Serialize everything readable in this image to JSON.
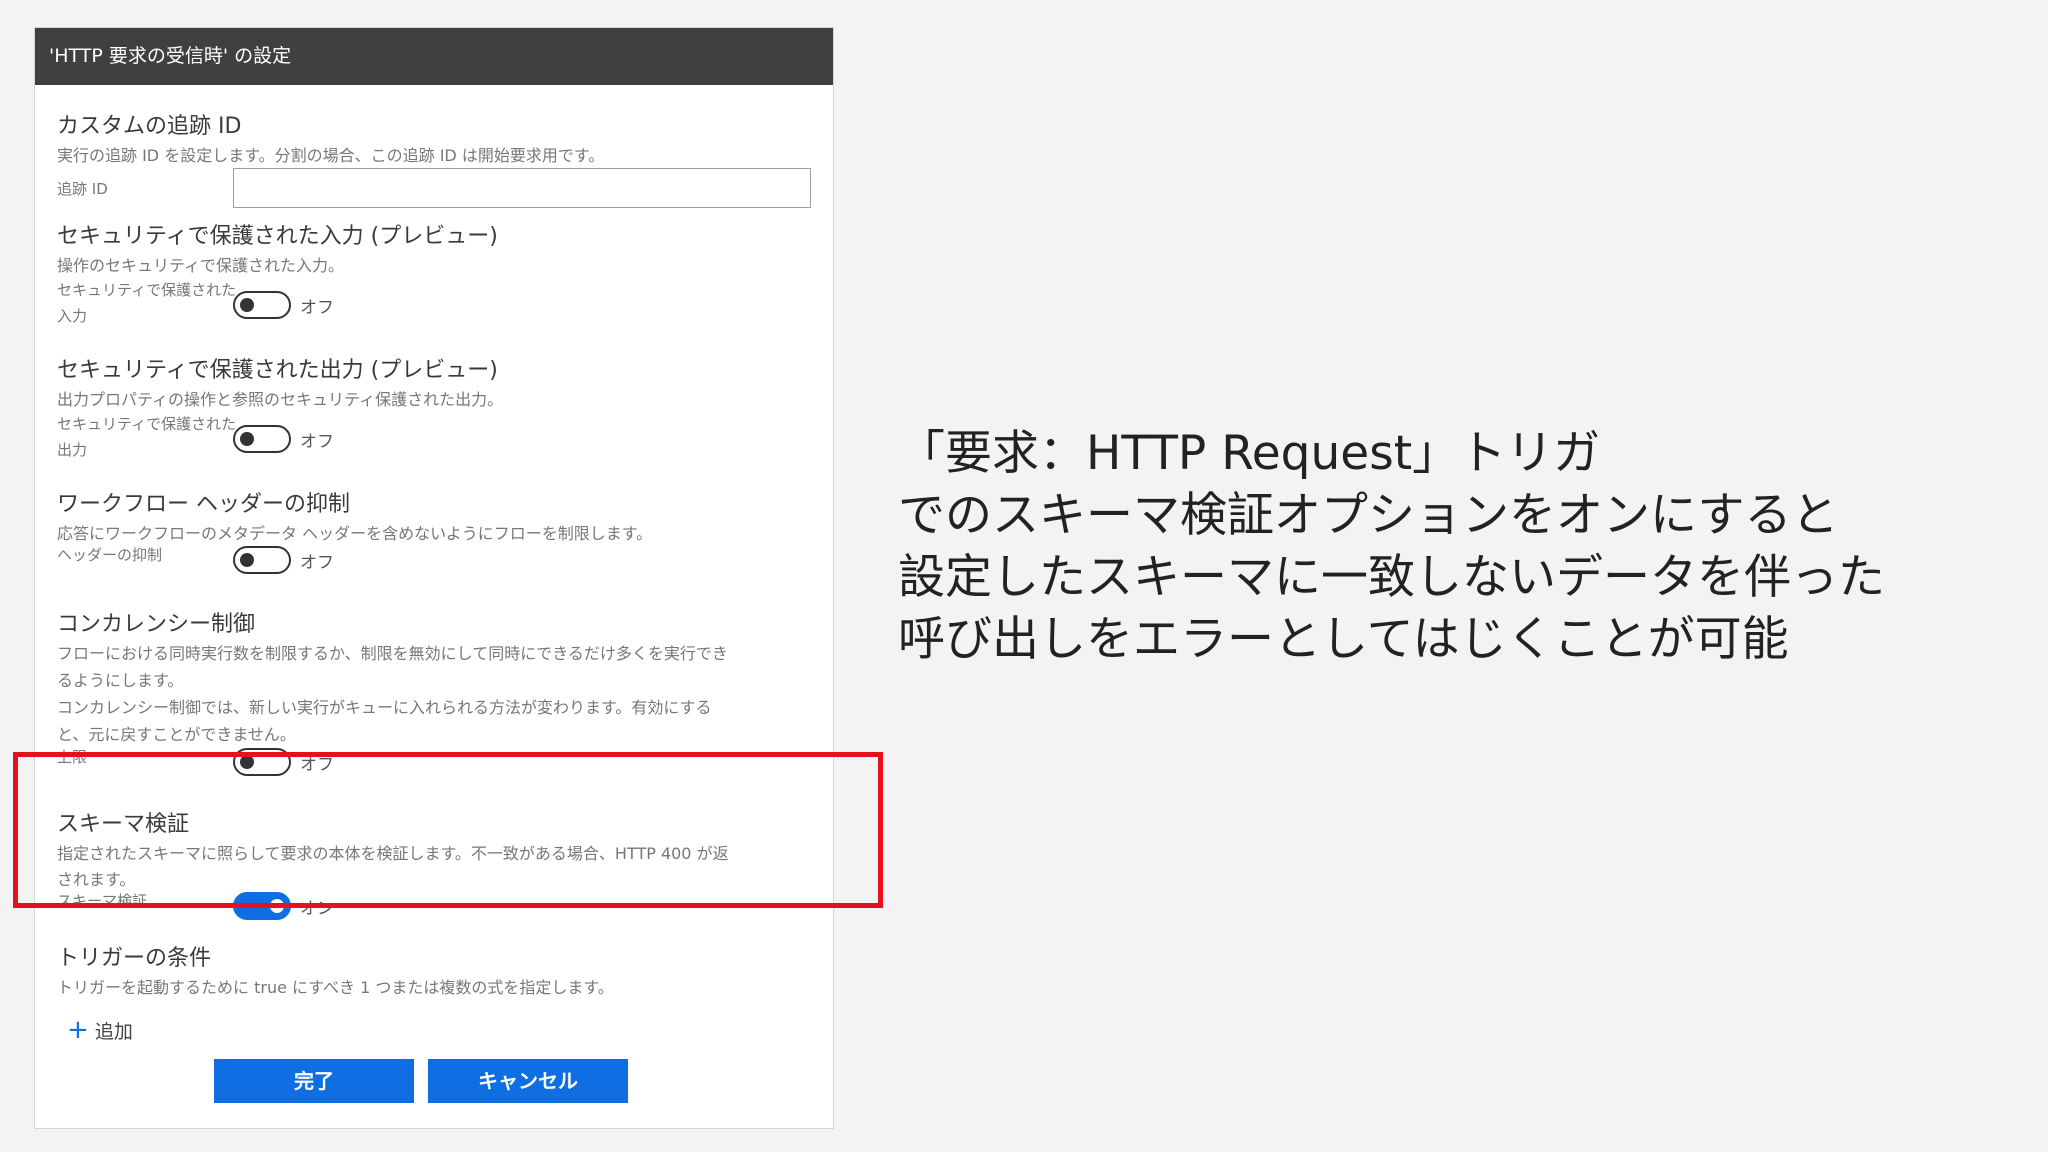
{
  "panel": {
    "title": "'HTTP 要求の受信時' の設定",
    "tracking": {
      "title": "カスタムの追跡 ID",
      "desc": "実行の追跡 ID を設定します。分割の場合、この追跡 ID は開始要求用です。",
      "field_label": "追跡 ID",
      "field_value": ""
    },
    "secure_input": {
      "title": "セキュリティで保護された入力 (プレビュー)",
      "desc": "操作のセキュリティで保護された入力。",
      "label_line1": "セキュリティで保護された",
      "label_line2": "入力",
      "state": "オフ"
    },
    "secure_output": {
      "title": "セキュリティで保護された出力 (プレビュー)",
      "desc": "出力プロパティの操作と参照のセキュリティ保護された出力。",
      "label_line1": "セキュリティで保護された",
      "label_line2": "出力",
      "state": "オフ"
    },
    "header_suppress": {
      "title": "ワークフロー ヘッダーの抑制",
      "desc": "応答にワークフローのメタデータ ヘッダーを含めないようにフローを制限します。",
      "label": "ヘッダーの抑制",
      "state": "オフ"
    },
    "concurrency": {
      "title": "コンカレンシー制御",
      "desc_line1": "フローにおける同時実行数を制限するか、制限を無効にして同時にできるだけ多くを実行でき",
      "desc_line2": "るようにします。",
      "desc_line3": "コンカレンシー制御では、新しい実行がキューに入れられる方法が変わります。有効にする",
      "desc_line4": "と、元に戻すことができません。",
      "label": "上限",
      "state": "オフ"
    },
    "schema": {
      "title": "スキーマ検証",
      "desc_line1": "指定されたスキーマに照らして要求の本体を検証します。不一致がある場合、HTTP 400 が返",
      "desc_line2": "されます。",
      "label": "スキーマ検証",
      "state": "オン"
    },
    "trigger": {
      "title": "トリガーの条件",
      "desc": "トリガーを起動するために true にすべき 1 つまたは複数の式を指定します。",
      "add_label": "追加"
    },
    "buttons": {
      "done": "完了",
      "cancel": "キャンセル"
    }
  },
  "caption": {
    "line1": "「要求：HTTP Request」トリガ",
    "line2": "でのスキーマ検証オプションをオンにすると",
    "line3": "設定したスキーマに一致しないデータを伴った",
    "line4": "呼び出しをエラーとしてはじくことが可能"
  },
  "colors": {
    "accent": "#0f6fe2",
    "highlight": "#e8101c",
    "header_bg": "#404040"
  }
}
